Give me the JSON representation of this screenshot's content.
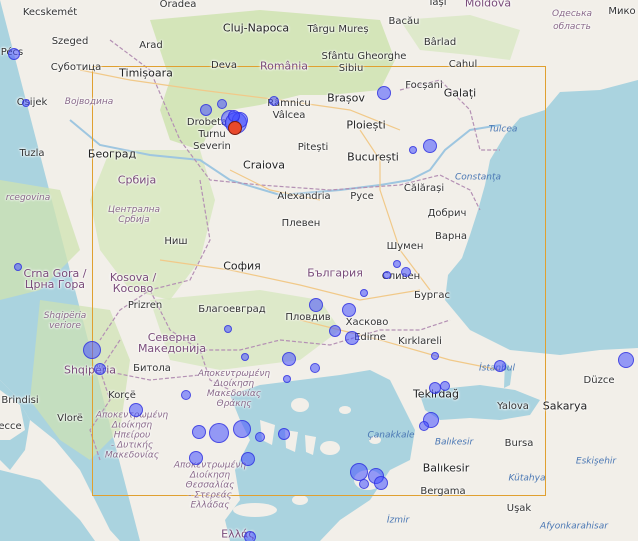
{
  "map": {
    "labels": {
      "kecskemet": "Kecskemét",
      "oradea": "Oradea",
      "cluj": "Cluj-Napoca",
      "targu": "Târgu Mureș",
      "bacau": "Bacău",
      "iasi": "Iași",
      "moldova": "Moldova",
      "odesa": "Одеська",
      "oblast": "область",
      "miko": "Мико",
      "pecs": "Pécs",
      "szeged": "Szeged",
      "arad": "Arad",
      "sfantu": "Sfântu Gheorghe",
      "barlad": "Bârlad",
      "subotica": "Суботица",
      "timisoara": "Timișoara",
      "deva": "Deva",
      "romania": "România",
      "sibiu": "Sibiu",
      "cahul": "Cahul",
      "osijek": "Osijek",
      "vojvodina": "Војводина",
      "drobeta": "Drobeta",
      "turnu": "Turnu",
      "severin": "Severin",
      "ramnicu": "Râmnicu",
      "valcea": "Vâlcea",
      "brasov": "Brașov",
      "focsani": "Focșani",
      "galati": "Galați",
      "ploiesti": "Ploiești",
      "tulcea": "Tulcea",
      "tuzla": "Tuzla",
      "beograd": "Београд",
      "craiova": "Craiova",
      "pitesti": "Pitești",
      "bucuresti": "București",
      "srbija": "Србија",
      "constanta": "Constanța",
      "calarasi": "Călărași",
      "herzegovina": "rcegovina",
      "alexandria": "Alexandria",
      "ruse": "Русе",
      "dobrich": "Добрич",
      "centralna": "Централна Србија",
      "pleven": "Плевен",
      "shumen": "Шумен",
      "varna": "Варна",
      "nis": "Ниш",
      "crnagora": "Crna Gora /\nЦрна Гора",
      "kosova": "Kosova /\nКосово",
      "sofia": "София",
      "bulgaria": "България",
      "sliven": "Сливен",
      "burgas": "Бургас",
      "prizren": "Prizren",
      "shqiperia_v": "Shqipëria\nveriore",
      "blagoevgrad": "Благоевград",
      "plovdiv": "Пловдив",
      "haskovo": "Хасково",
      "severna": "Северна\nМакедонија",
      "edirne": "Edirne",
      "kirklareli": "Kırklareli",
      "shqiperia": "Shqipëria",
      "bitola": "Битола",
      "istanbul": "İstanbul",
      "duzce": "Düzce",
      "anat": "Αποκεντρωμένη\nΔιοίκηση\nΜακεδονίας\nΘράκης",
      "tekirdag": "Tekirdağ",
      "brindisi": "Brindisi",
      "korce": "Korçë",
      "yalova": "Yalova",
      "sakarya": "Sakarya",
      "vlore": "Vlorë",
      "epirus": "Αποκεντρωμένη\nΔιοίκηση\nΗπείρου\n- Δυτικής\nΜακεδονίας",
      "lecce": "ecce",
      "canakkale": "Çanakkale",
      "balikesir_p": "Balıkesir",
      "bursa": "Bursa",
      "eskisehir": "Eskişehir",
      "thessaly": "Αποκεντρωμένη\nΔιοίκηση\nΘεσσαλίας\n- Στερεάς\nΕλλάδας",
      "balikesir": "Balıkesir",
      "kutahya": "Kütahya",
      "bergama": "Bergama",
      "usak": "Uşak",
      "izmir": "İzmir",
      "afyon": "Afyonkarahisar",
      "ellas": "Ελλάς"
    }
  }
}
